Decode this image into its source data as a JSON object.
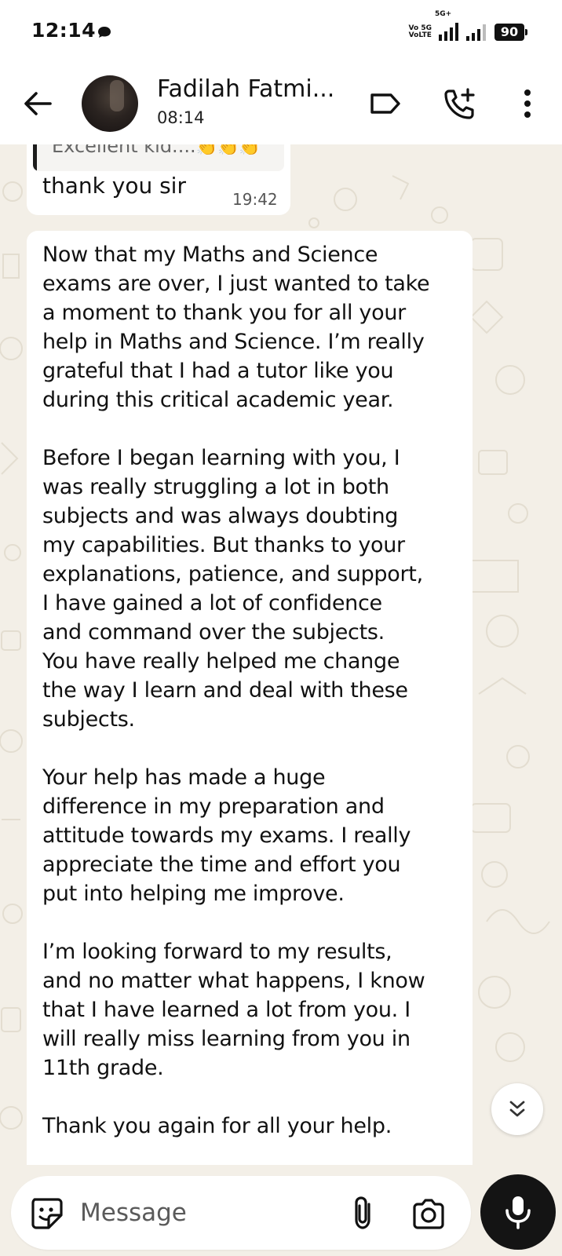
{
  "status_bar": {
    "time": "12:14",
    "volte_line1": "Vo 5G",
    "volte_line2": "VoLTE",
    "net_label": "5G+",
    "battery": "90"
  },
  "header": {
    "contact_name": "Fadilah Fatmi...",
    "status": "08:14",
    "icons": [
      "back-arrow-icon",
      "label-icon",
      "add-call-icon",
      "more-vert-icon"
    ]
  },
  "messages": {
    "quoted": {
      "text": "Excellent kid....",
      "emoji": "👏👏👏"
    },
    "reply": {
      "text": "thank you sir",
      "time": "19:42"
    },
    "long_message": {
      "text": "Now that my Maths and Science\nexams are over, I just wanted to take\na moment to thank you for all your\nhelp in Maths and Science. I’m really\ngrateful that I had a tutor like you\nduring this critical academic year.\n\nBefore I began learning with you, I\nwas really struggling a lot in both\nsubjects and was always doubting\nmy capabilities. But thanks to your\nexplanations, patience, and support,\nI have gained a lot of confidence\nand command over the subjects.\nYou have really helped me change\nthe way I learn and deal with these\nsubjects.\n\nYour help has made a huge\ndifference in my preparation and\nattitude towards my exams. I really\nappreciate the time and effort you\nput into helping me improve.\n\nI’m looking forward to my results,\nand no matter what happens, I know\nthat I have learned a lot from you. I\nwill really miss learning from you in\n11th grade.\n\nThank you again for all your help."
    }
  },
  "input_bar": {
    "placeholder": "Message",
    "icons": [
      "sticker-icon",
      "paperclip-icon",
      "camera-icon",
      "mic-icon"
    ]
  },
  "colors": {
    "wallpaper": "#f3efe7",
    "bubble": "#ffffff",
    "mic_button": "#141414"
  }
}
